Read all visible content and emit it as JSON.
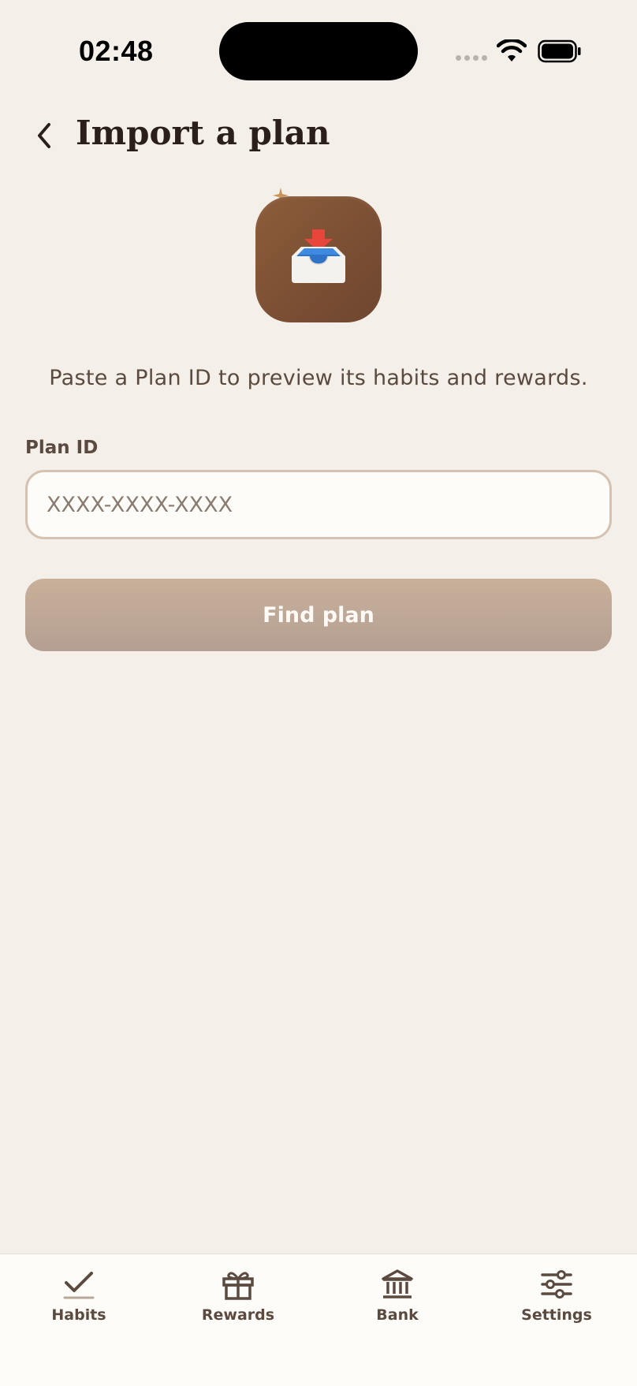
{
  "status_bar": {
    "time": "02:48"
  },
  "header": {
    "title": "Import a plan"
  },
  "hero": {
    "icon": "inbox-tray-icon"
  },
  "subtitle": "Paste a Plan ID to preview its habits and rewards.",
  "plan_id": {
    "label": "Plan ID",
    "placeholder": "XXXX-XXXX-XXXX",
    "value": ""
  },
  "find_button": {
    "label": "Find plan"
  },
  "tabs": [
    {
      "label": "Habits",
      "icon": "checkmark-icon"
    },
    {
      "label": "Rewards",
      "icon": "gift-icon"
    },
    {
      "label": "Bank",
      "icon": "bank-icon"
    },
    {
      "label": "Settings",
      "icon": "sliders-icon"
    }
  ],
  "colors": {
    "background": "#f4efe8",
    "accent_brown": "#7a4e33",
    "button": "#c0a895",
    "text_dark": "#2a1f1a",
    "text_muted": "#5b4a3f"
  }
}
